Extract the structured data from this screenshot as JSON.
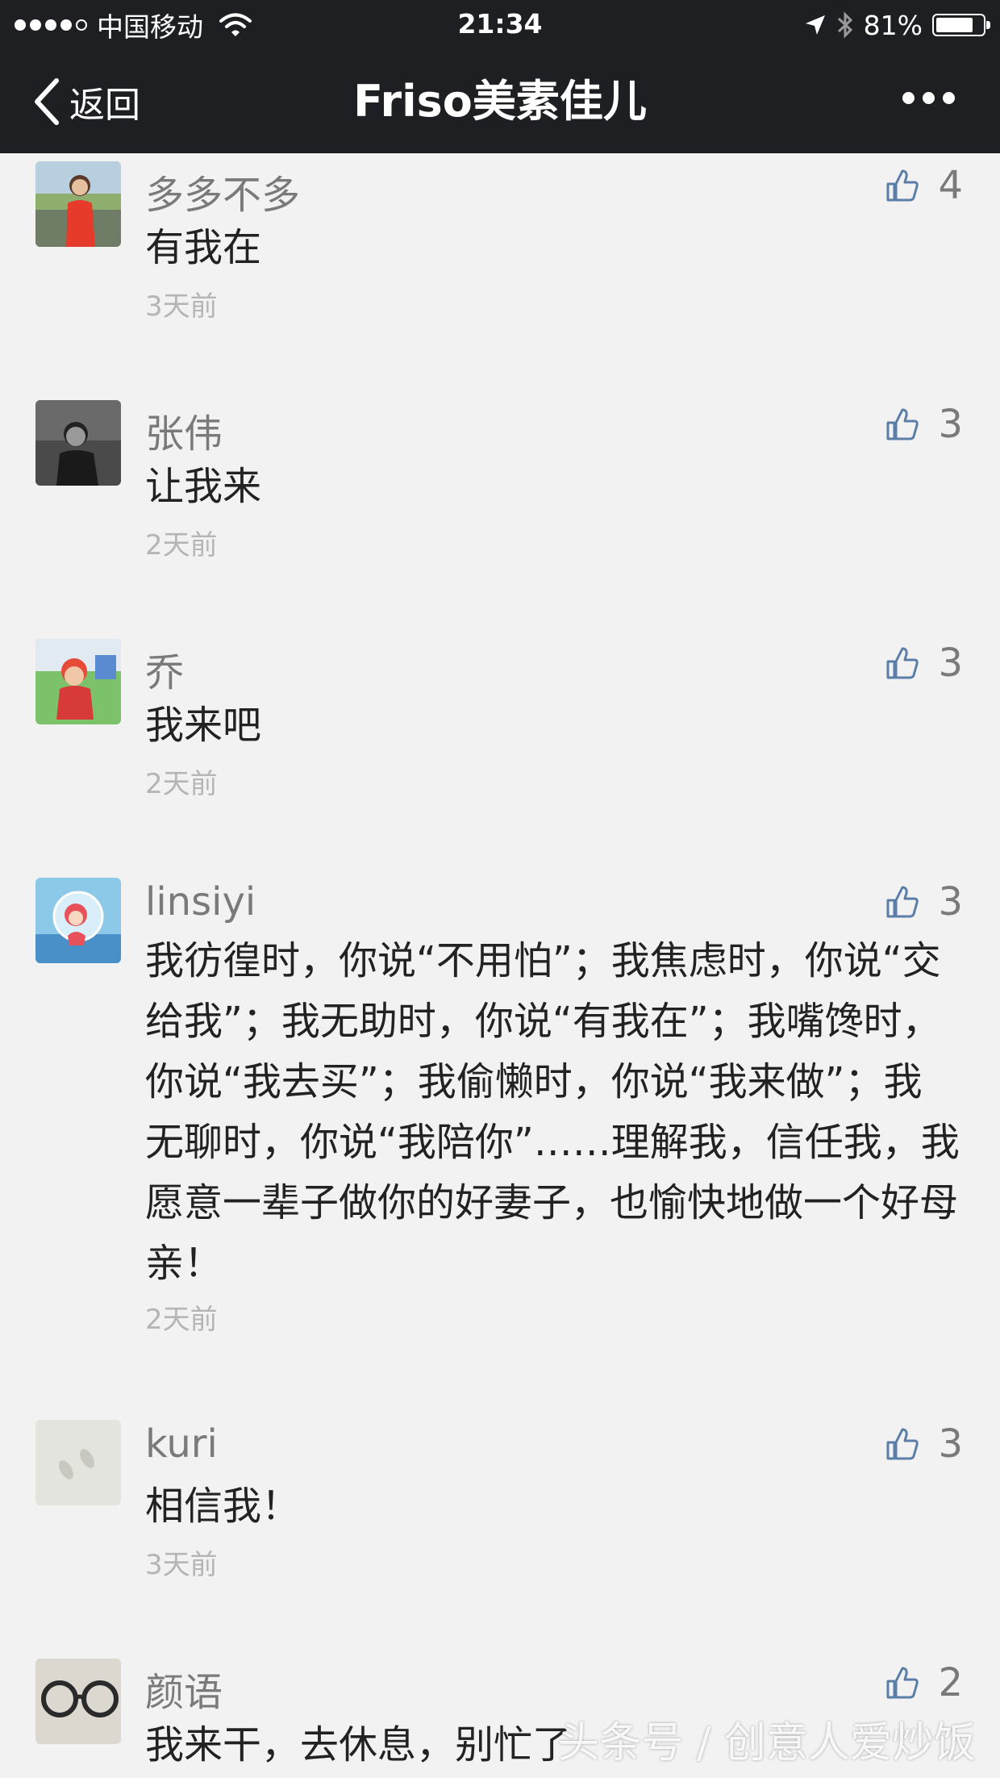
{
  "status_bar": {
    "carrier": "中国移动",
    "time": "21:34",
    "battery": "81%",
    "battery_level": 0.81
  },
  "nav": {
    "back_label": "返回",
    "title": "Friso美素佳儿"
  },
  "comments": [
    {
      "name": "多多不多",
      "text": "有我在",
      "time": "3天前",
      "likes": "4"
    },
    {
      "name": "张伟",
      "text": "让我来",
      "time": "2天前",
      "likes": "3"
    },
    {
      "name": "乔",
      "text": "我来吧",
      "time": "2天前",
      "likes": "3"
    },
    {
      "name": "linsiyi",
      "text": "我彷徨时，你说“不用怕”；我焦虑时，你说“交给我”；我无助时，你说“有我在”；我嘴馋时，你说“我去买”；我偷懒时，你说“我来做”；我无聊时，你说“我陪你”……理解我，信任我，我愿意一辈子做你的好妻子，也愉快地做一个好母亲！",
      "time": "2天前",
      "likes": "3"
    },
    {
      "name": "kuri",
      "text": "相信我！",
      "time": "3天前",
      "likes": "3"
    },
    {
      "name": "颜语",
      "text": "我来干，去休息，别忙了",
      "time": "",
      "likes": "2"
    }
  ],
  "watermark": "头条号 / 创意人爱炒饭",
  "colors": {
    "header_bg": "#1e1f23",
    "page_bg": "#f2f2f2",
    "thumb_icon": "#5a7ea8"
  }
}
